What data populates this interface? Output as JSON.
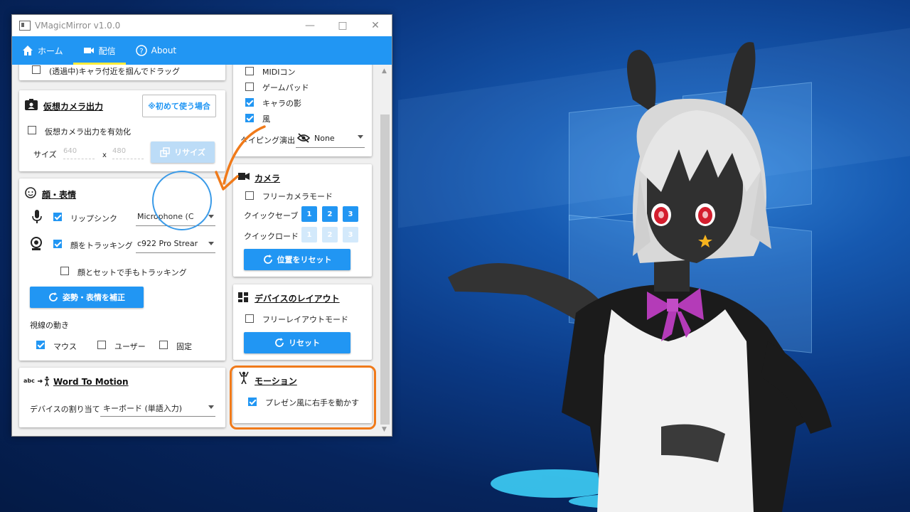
{
  "window": {
    "title": "VMagicMirror v1.0.0"
  },
  "nav": {
    "home": "ホーム",
    "stream": "配信",
    "about": "About"
  },
  "left": {
    "top_drag_label": "(透過中)キャラ付近を掴んでドラッグ",
    "vcam": {
      "title": "仮想カメラ出力",
      "first_time_btn": "※初めて使う場合",
      "enable_label": "仮想カメラ出力を有効化",
      "size_label": "サイズ",
      "width": "640",
      "x": "x",
      "height": "480",
      "resize_btn": "リサイズ"
    },
    "face": {
      "title": "顔・表情",
      "lipsync_label": "リップシンク",
      "mic_value": "Microphone (C",
      "face_tracking_label": "顔をトラッキング",
      "camera_value": "c922 Pro Strear",
      "hand_tracking_label": "顔とセットで手もトラッキング",
      "calibrate_btn": "姿勢・表情を補正",
      "gaze_label": "視線の動き",
      "gaze_mouse": "マウス",
      "gaze_user": "ユーザー",
      "gaze_fixed": "固定"
    },
    "wtm": {
      "icon_text": "abc",
      "title": "Word To Motion",
      "device_label": "デバイスの割り当て",
      "device_value": "キーボード (単語入力)"
    }
  },
  "right": {
    "midi": "MIDIコン",
    "gamepad": "ゲームパッド",
    "shadow": "キャラの影",
    "wind": "風",
    "typing_label": "タイピング演出",
    "typing_value": "None",
    "camera": {
      "title": "カメラ",
      "free_mode": "フリーカメラモード",
      "quick_save": "クイックセーブ",
      "quick_load": "クイックロード",
      "slot1": "1",
      "slot2": "2",
      "slot3": "3",
      "reset_btn": "位置をリセット"
    },
    "layout": {
      "title": "デバイスのレイアウト",
      "free_mode": "フリーレイアウトモード",
      "reset_btn": "リセット"
    },
    "motion": {
      "title": "モーション",
      "present_label": "プレゼン風に右手を動かす"
    }
  },
  "colors": {
    "accent": "#2196f3",
    "highlight": "#f07a1a",
    "underline": "#ffeb3b"
  }
}
